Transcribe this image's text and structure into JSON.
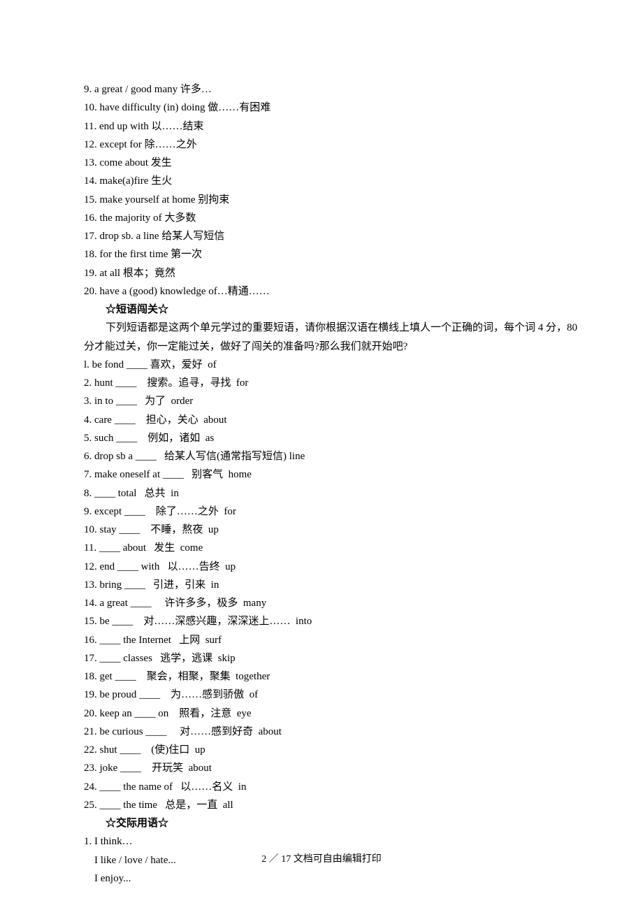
{
  "list1": [
    "9. a great / good many 许多…",
    "10. have difficulty (in) doing 做……有困难",
    "11. end up with 以……结束",
    "12. except for 除……之外",
    "13. come about 发生",
    "14. make(a)fire 生火",
    "15. make yourself at home 别拘束",
    "16. the majority of 大多数",
    "17. drop sb. a line 给某人写短信",
    "18. for the first time 第一次",
    "19. at all 根本；竟然",
    "20. have a (good) knowledge of…精通……"
  ],
  "heading1": "☆短语闯关☆",
  "intro": [
    "下列短语都是这两个单元学过的重要短语，请你根据汉语在横线上填人一个正确的词，每个词 4 分，80",
    "分才能过关，你一定能过关，做好了闯关的准备吗?那么我们就开始吧?"
  ],
  "list2": [
    "l. be fond ____ 喜欢，爱好  of",
    "2. hunt ____    搜索。追寻，寻找  for",
    "3. in to ____   为了  order",
    "4. care ____    担心，关心  about",
    "5. such ____    例如，诸如  as",
    "6. drop sb a ____   给某人写信(通常指写短信) line",
    "7. make oneself at ____   别客气  home",
    "8. ____ total   总共  in",
    "9. except ____    除了……之外  for",
    "10. stay ____    不睡，熬夜  up",
    "11. ____ about   发生  come",
    "12. end ____ with   以……告终  up",
    "13. bring ____   引进，引来  in",
    "14. a great ____     许许多多，极多  many",
    "15. be ____    对……深感兴趣，深深迷上……  into",
    "16. ____ the Internet   上网  surf",
    "17. ____ classes   逃学，逃课  skip",
    "18. get ____    聚会，相聚，聚集  together",
    "19. be proud ____    为……感到骄傲  of",
    "20. keep an ____ on    照看，注意  eye",
    "21. be curious ____     对……感到好奇  about",
    "22. shut ____    (使)住口  up",
    "23. joke ____    开玩笑  about",
    "24. ____ the name of   以……名义  in",
    "25. ____ the time   总是，一直  all"
  ],
  "heading2": "☆交际用语☆",
  "list3_lead": "1. I think…",
  "list3_sub": [
    "I like / love / hate...",
    "I enjoy..."
  ],
  "footer": "2 ／ 17 文档可自由编辑打印"
}
